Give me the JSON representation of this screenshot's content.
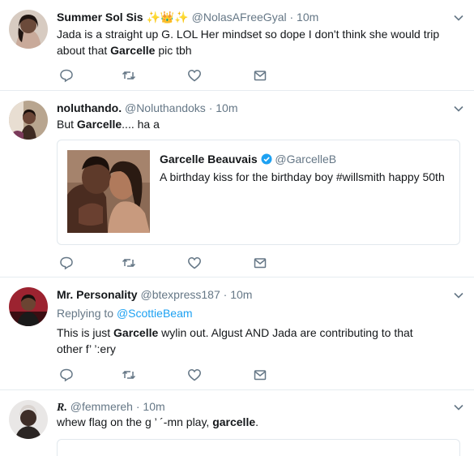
{
  "tweets": [
    {
      "name": "Summer Sol Sis",
      "emoji": "✨👑✨",
      "handle": "@NolasAFreeGyal",
      "dot": "·",
      "time": "10m",
      "text_a": "Jada is a straight up G. LOL Her mindset so dope I don't think she would trip about that ",
      "text_b": "Garcelle",
      "text_c": " pic tbh"
    },
    {
      "name": "noluthando.",
      "handle": "@Noluthandoks",
      "dot": "·",
      "time": "10m",
      "text_a": "But ",
      "text_b": "Garcelle",
      "text_c": ".... ha a",
      "quote": {
        "name": "Garcelle Beauvais",
        "handle": "@GarcelleB",
        "text": "A birthday kiss for the birthday boy #willsmith happy 50th"
      }
    },
    {
      "name": "Mr. Personality",
      "handle": "@btexpress187",
      "dot": "·",
      "time": "10m",
      "replying_label": "Replying to ",
      "replying_handle": "@ScottieBeam",
      "text_a": "This is just ",
      "text_b": "Garcelle",
      "text_c": " wylin out. Algust AND Jada are contributing to that other f’ ’:ery"
    },
    {
      "name": "R.",
      "handle": "@femmereh",
      "dot": "·",
      "time": "10m",
      "text_a": "whew flag on the g  ’ ´-mn play, ",
      "text_b": "garcelle",
      "text_c": "."
    }
  ],
  "colors": {
    "accent": "#1da1f2",
    "secondary_text": "#657786",
    "divider": "#e6ecf0"
  },
  "icons": [
    "reply-icon",
    "retweet-icon",
    "like-icon",
    "message-icon",
    "chevron-down-icon",
    "verified-icon"
  ]
}
